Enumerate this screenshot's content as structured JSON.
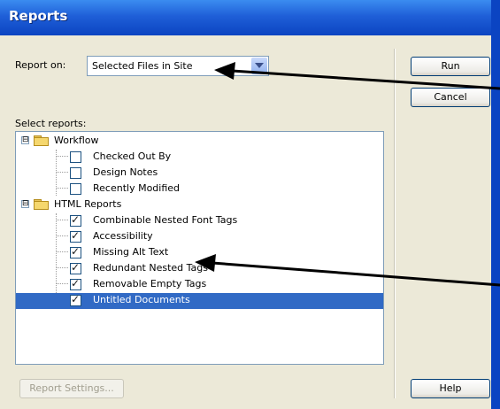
{
  "window": {
    "title": "Reports"
  },
  "report_on": {
    "label": "Report on:",
    "value": "Selected Files in Site"
  },
  "buttons": {
    "run": "Run",
    "cancel": "Cancel",
    "help": "Help",
    "report_settings": "Report Settings..."
  },
  "select_reports_label": "Select reports:",
  "tree": {
    "groups": [
      {
        "label": "Workflow",
        "expander": "⊟",
        "items": [
          {
            "label": "Checked Out By",
            "checked": false
          },
          {
            "label": "Design Notes",
            "checked": false
          },
          {
            "label": "Recently Modified",
            "checked": false
          }
        ]
      },
      {
        "label": "HTML Reports",
        "expander": "⊟",
        "items": [
          {
            "label": "Combinable Nested Font Tags",
            "checked": true
          },
          {
            "label": "Accessibility",
            "checked": true
          },
          {
            "label": "Missing Alt Text",
            "checked": true
          },
          {
            "label": "Redundant Nested Tags",
            "checked": true
          },
          {
            "label": "Removable Empty Tags",
            "checked": true
          },
          {
            "label": "Untitled Documents",
            "checked": true,
            "selected": true
          }
        ]
      }
    ]
  },
  "colors": {
    "title_bar": "#1f5fd8",
    "selection": "#316ac5",
    "dialog_bg": "#ece9d8"
  }
}
